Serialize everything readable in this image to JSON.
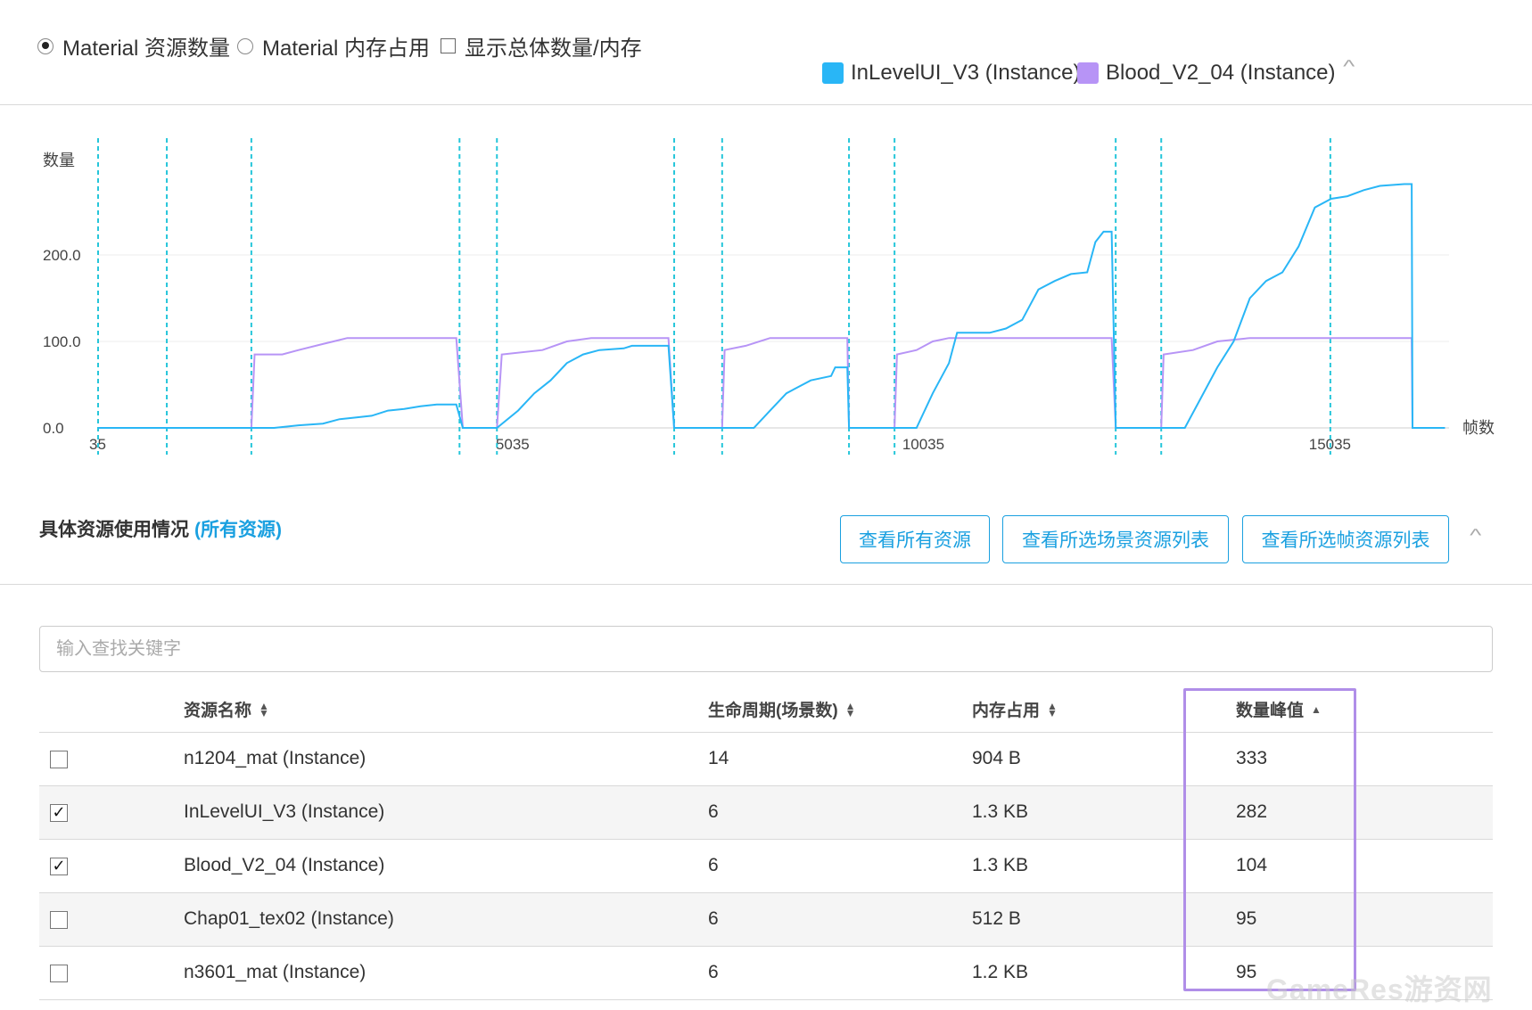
{
  "controls": {
    "radio_count": "Material 资源数量",
    "radio_memory": "Material 内存占用",
    "checkbox_total": "显示总体数量/内存"
  },
  "legend": [
    {
      "name": "InLevelUI_V3 (Instance)",
      "color": "#29b6f6"
    },
    {
      "name": "Blood_V2_04 (Instance)",
      "color": "#b794f6"
    }
  ],
  "chart_data": {
    "type": "line",
    "ylabel": "数量",
    "xlabel": "帧数",
    "y_ticks": [
      0,
      100,
      200
    ],
    "y_tick_labels": [
      "0.0",
      "100.0",
      "200.0"
    ],
    "x_ticks": [
      35,
      5035,
      10035,
      15035
    ],
    "x_tick_labels": [
      "35",
      "5035",
      "10035",
      "15035"
    ],
    "xlim": [
      35,
      16650
    ],
    "ylim": [
      0,
      330
    ],
    "scene_markers": [
      35,
      880,
      1920,
      4480,
      4940,
      7120,
      7710,
      9270,
      9830,
      12550,
      13110,
      15190
    ],
    "series": [
      {
        "name": "InLevelUI_V3 (Instance)",
        "color": "#29b6f6",
        "points": [
          [
            35,
            0
          ],
          [
            1920,
            0
          ],
          [
            2200,
            0
          ],
          [
            2500,
            3
          ],
          [
            2800,
            5
          ],
          [
            3000,
            10
          ],
          [
            3200,
            12
          ],
          [
            3400,
            14
          ],
          [
            3600,
            20
          ],
          [
            3800,
            22
          ],
          [
            4000,
            25
          ],
          [
            4200,
            27
          ],
          [
            4440,
            27
          ],
          [
            4520,
            0
          ],
          [
            4940,
            0
          ],
          [
            5200,
            20
          ],
          [
            5400,
            40
          ],
          [
            5600,
            55
          ],
          [
            5800,
            75
          ],
          [
            6000,
            85
          ],
          [
            6200,
            90
          ],
          [
            6500,
            92
          ],
          [
            6600,
            95
          ],
          [
            7050,
            95
          ],
          [
            7120,
            0
          ],
          [
            7710,
            0
          ],
          [
            8100,
            0
          ],
          [
            8300,
            20
          ],
          [
            8500,
            40
          ],
          [
            8800,
            55
          ],
          [
            9050,
            60
          ],
          [
            9100,
            70
          ],
          [
            9250,
            70
          ],
          [
            9270,
            0
          ],
          [
            9830,
            0
          ],
          [
            10100,
            0
          ],
          [
            10300,
            40
          ],
          [
            10500,
            75
          ],
          [
            10600,
            110
          ],
          [
            11000,
            110
          ],
          [
            11200,
            115
          ],
          [
            11400,
            125
          ],
          [
            11600,
            160
          ],
          [
            11800,
            170
          ],
          [
            12000,
            178
          ],
          [
            12200,
            180
          ],
          [
            12300,
            215
          ],
          [
            12400,
            227
          ],
          [
            12500,
            227
          ],
          [
            12550,
            0
          ],
          [
            13110,
            0
          ],
          [
            13400,
            0
          ],
          [
            13600,
            35
          ],
          [
            13800,
            70
          ],
          [
            14000,
            100
          ],
          [
            14200,
            150
          ],
          [
            14400,
            170
          ],
          [
            14600,
            180
          ],
          [
            14800,
            210
          ],
          [
            15000,
            255
          ],
          [
            15200,
            265
          ],
          [
            15400,
            268
          ],
          [
            15600,
            275
          ],
          [
            15800,
            280
          ],
          [
            16100,
            282
          ],
          [
            16190,
            282
          ],
          [
            16200,
            0
          ],
          [
            16600,
            0
          ]
        ]
      },
      {
        "name": "Blood_V2_04 (Instance)",
        "color": "#b794f6",
        "points": [
          [
            35,
            0
          ],
          [
            1920,
            0
          ],
          [
            1960,
            85
          ],
          [
            2300,
            85
          ],
          [
            2500,
            90
          ],
          [
            2800,
            97
          ],
          [
            3100,
            104
          ],
          [
            4440,
            104
          ],
          [
            4520,
            0
          ],
          [
            4940,
            0
          ],
          [
            5000,
            85
          ],
          [
            5500,
            90
          ],
          [
            5800,
            100
          ],
          [
            6100,
            104
          ],
          [
            7050,
            104
          ],
          [
            7120,
            0
          ],
          [
            7710,
            0
          ],
          [
            7740,
            90
          ],
          [
            8000,
            95
          ],
          [
            8300,
            104
          ],
          [
            9250,
            104
          ],
          [
            9270,
            0
          ],
          [
            9830,
            0
          ],
          [
            9860,
            85
          ],
          [
            10100,
            90
          ],
          [
            10300,
            100
          ],
          [
            10500,
            104
          ],
          [
            12500,
            104
          ],
          [
            12550,
            0
          ],
          [
            13110,
            0
          ],
          [
            13140,
            85
          ],
          [
            13500,
            90
          ],
          [
            13800,
            100
          ],
          [
            14200,
            104
          ],
          [
            16190,
            104
          ],
          [
            16200,
            0
          ],
          [
            16600,
            0
          ]
        ]
      }
    ],
    "grid": true
  },
  "section": {
    "title": "具体资源使用情况",
    "link": "(所有资源)",
    "buttons": {
      "all": "查看所有资源",
      "scene": "查看所选场景资源列表",
      "frame": "查看所选帧资源列表"
    }
  },
  "search": {
    "placeholder": "输入查找关键字"
  },
  "table": {
    "headers": {
      "name": "资源名称",
      "lifecycle": "生命周期(场景数)",
      "memory": "内存占用",
      "peak": "数量峰值"
    },
    "rows": [
      {
        "checked": false,
        "name": "n1204_mat (Instance)",
        "lifecycle": "14",
        "memory": "904 B",
        "peak": "333"
      },
      {
        "checked": true,
        "name": "InLevelUI_V3 (Instance)",
        "lifecycle": "6",
        "memory": "1.3 KB",
        "peak": "282"
      },
      {
        "checked": true,
        "name": "Blood_V2_04 (Instance)",
        "lifecycle": "6",
        "memory": "1.3 KB",
        "peak": "104"
      },
      {
        "checked": false,
        "name": "Chap01_tex02 (Instance)",
        "lifecycle": "6",
        "memory": "512 B",
        "peak": "95"
      },
      {
        "checked": false,
        "name": "n3601_mat (Instance)",
        "lifecycle": "6",
        "memory": "1.2 KB",
        "peak": "95"
      }
    ]
  },
  "watermark": "GameRes游资网"
}
